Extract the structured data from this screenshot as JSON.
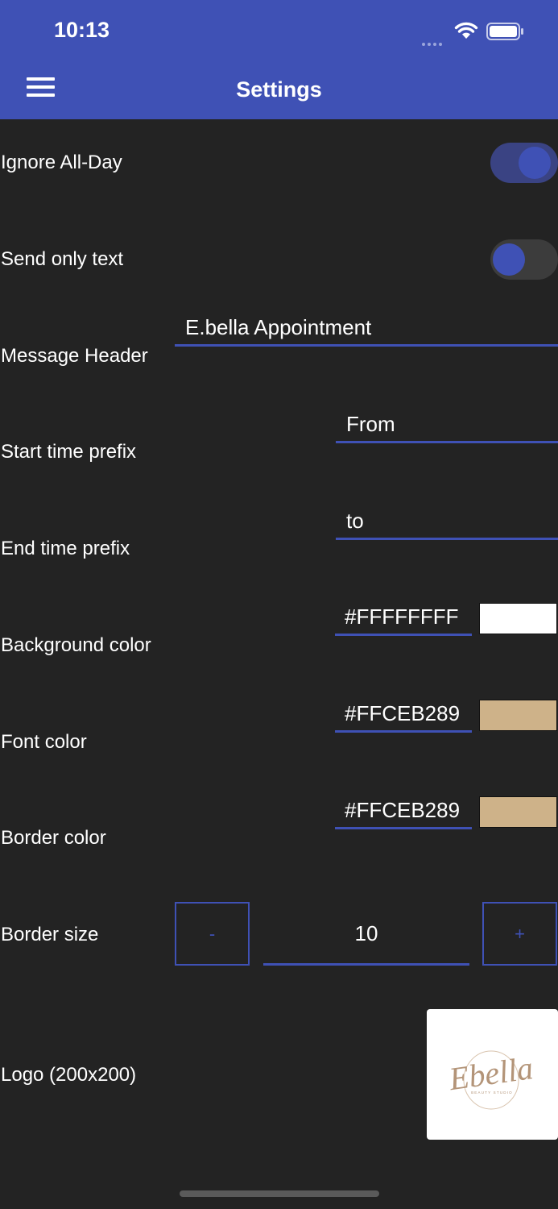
{
  "status_bar": {
    "time": "10:13"
  },
  "header": {
    "title": "Settings"
  },
  "settings": {
    "ignore_all_day": {
      "label": "Ignore All-Day",
      "value": true
    },
    "send_only_text": {
      "label": "Send only text",
      "value": false
    },
    "message_header": {
      "label": "Message Header",
      "value": "E.bella Appointment"
    },
    "start_time_prefix": {
      "label": "Start time prefix",
      "value": "From"
    },
    "end_time_prefix": {
      "label": "End time prefix",
      "value": "to"
    },
    "background_color": {
      "label": "Background color",
      "value": "#FFFFFFFF",
      "swatch": "#ffffff"
    },
    "font_color": {
      "label": "Font color",
      "value": "#FFCEB289",
      "swatch": "#ceb289"
    },
    "border_color": {
      "label": "Border color",
      "value": "#FFCEB289",
      "swatch": "#ceb289"
    },
    "border_size": {
      "label": "Border size",
      "decrement": "-",
      "value": "10",
      "increment": "+"
    },
    "logo": {
      "label": "Logo (200x200)",
      "script_text": "Ebella",
      "subtitle": "BEAUTY STUDIO"
    }
  },
  "colors": {
    "accent": "#3f51b5",
    "background": "#232323",
    "logo_gold": "#c9a98a"
  }
}
